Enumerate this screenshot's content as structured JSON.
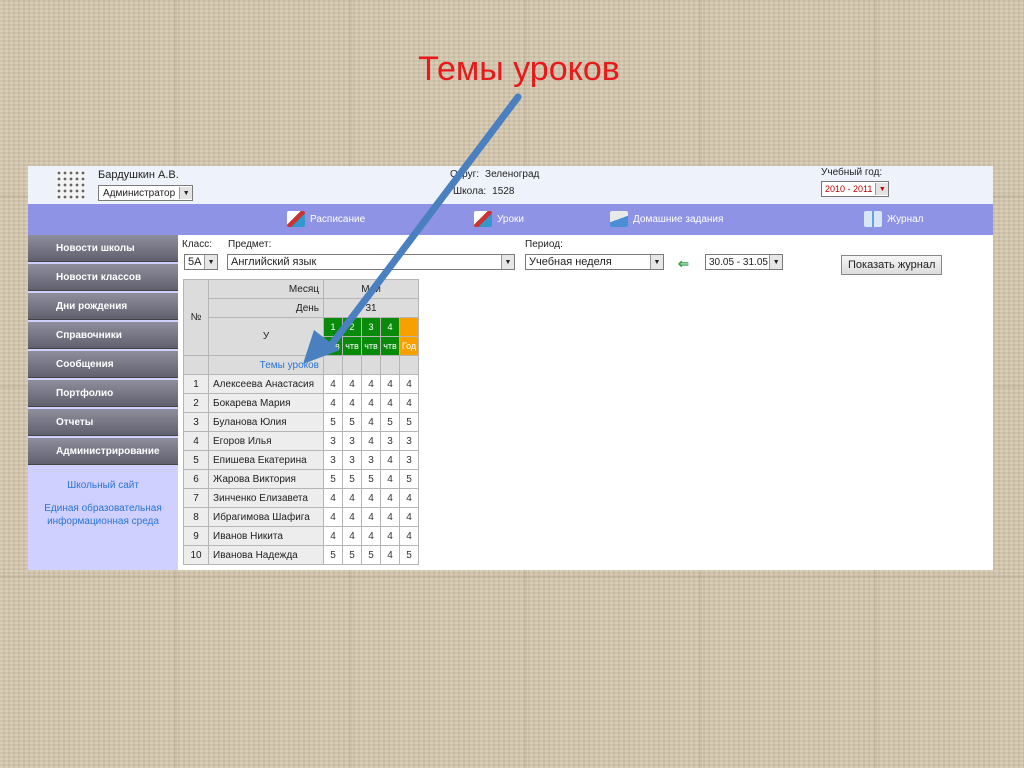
{
  "slide": {
    "title": "Темы уроков"
  },
  "header": {
    "user_name": "Бардушкин А.В.",
    "role": "Администратор",
    "okrug_label": "Округ:",
    "okrug_value": "Зеленоград",
    "school_label": "Школа:",
    "school_value": "1528",
    "year_label": "Учебный год:",
    "year_value": "2010 - 2011"
  },
  "nav": {
    "items": [
      {
        "label": "Расписание",
        "icon": "schedule-icon"
      },
      {
        "label": "Уроки",
        "icon": "lessons-icon"
      },
      {
        "label": "Домашние задания",
        "icon": "homework-icon"
      },
      {
        "label": "Журнал",
        "icon": "journal-icon"
      }
    ]
  },
  "sidebar": {
    "items": [
      "Новости школы",
      "Новости классов",
      "Дни рождения",
      "Справочники",
      "Сообщения",
      "Портфолио",
      "Отчеты",
      "Администрирование"
    ],
    "links": [
      "Школьный сайт",
      "Единая образовательная информационная среда"
    ]
  },
  "filters": {
    "class_label": "Класс:",
    "class_value": "5А",
    "subject_label": "Предмет:",
    "subject_value": "Английский язык",
    "period_label": "Период:",
    "period_value": "Учебная неделя",
    "week_value": "30.05 - 31.05",
    "show_button": "Показать журнал"
  },
  "journal": {
    "month_label": "Месяц",
    "month_value": "Май",
    "day_label": "День",
    "day_value": "31",
    "no_label": "№",
    "lesson_label": "У",
    "quarter_numbers": [
      "1",
      "2",
      "3",
      "4"
    ],
    "quarter_abbr": [
      "чтв",
      "чтв",
      "чтв",
      "чтв"
    ],
    "year_col": "Год",
    "topics_label": "Темы уроков",
    "students": [
      {
        "n": "1",
        "name": "Алексеева Анастасия",
        "grades": [
          "4",
          "4",
          "4",
          "4",
          "4"
        ]
      },
      {
        "n": "2",
        "name": "Бокарева Мария",
        "grades": [
          "4",
          "4",
          "4",
          "4",
          "4"
        ]
      },
      {
        "n": "3",
        "name": "Буланова Юлия",
        "grades": [
          "5",
          "5",
          "4",
          "5",
          "5"
        ]
      },
      {
        "n": "4",
        "name": "Егоров Илья",
        "grades": [
          "3",
          "3",
          "4",
          "3",
          "3"
        ]
      },
      {
        "n": "5",
        "name": "Епишева Екатерина",
        "grades": [
          "3",
          "3",
          "3",
          "4",
          "3"
        ]
      },
      {
        "n": "6",
        "name": "Жарова Виктория",
        "grades": [
          "5",
          "5",
          "5",
          "4",
          "5"
        ]
      },
      {
        "n": "7",
        "name": "Зинченко Елизавета",
        "grades": [
          "4",
          "4",
          "4",
          "4",
          "4"
        ]
      },
      {
        "n": "8",
        "name": "Ибрагимова Шафига",
        "grades": [
          "4",
          "4",
          "4",
          "4",
          "4"
        ]
      },
      {
        "n": "9",
        "name": "Иванов Никита",
        "grades": [
          "4",
          "4",
          "4",
          "4",
          "4"
        ]
      },
      {
        "n": "10",
        "name": "Иванова Надежда",
        "grades": [
          "5",
          "5",
          "5",
          "4",
          "5"
        ]
      }
    ]
  },
  "colors": {
    "title": "#e8191b",
    "nav_bg": "#8f93e6",
    "sidebar_bg": "#cfd0ff",
    "arrow": "#4a7fc0",
    "quarter_green": "#0a8a0a",
    "year_orange": "#f7a000"
  }
}
